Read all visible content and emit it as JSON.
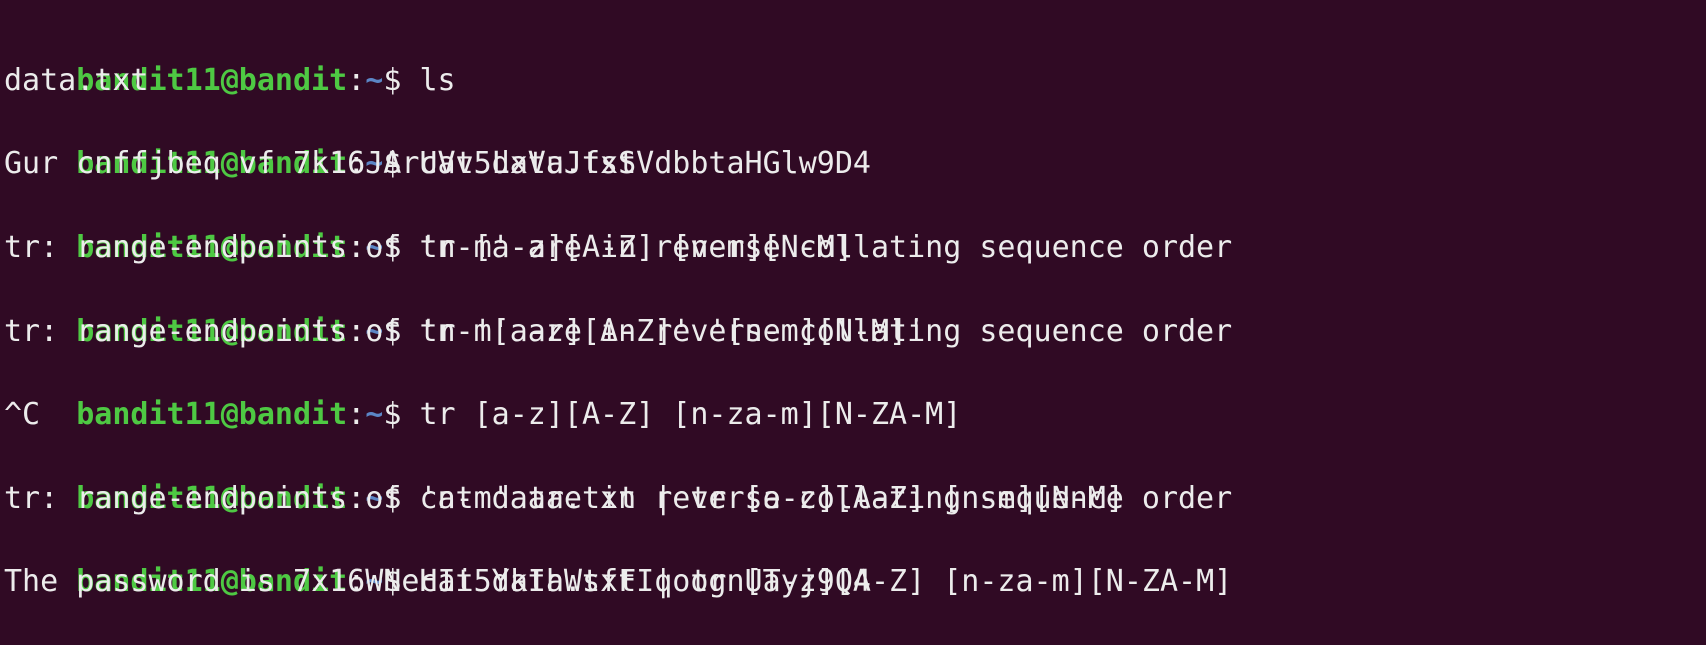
{
  "prompt": {
    "user_host": "bandit11@bandit",
    "colon": ":",
    "path": "~",
    "symbol": "$ "
  },
  "lines": [
    {
      "type": "command",
      "text": "ls"
    },
    {
      "type": "output",
      "text": "data.txt"
    },
    {
      "type": "command",
      "text": "cat data.txt"
    },
    {
      "type": "output",
      "text": "Gur cnffjbeq vf 7k16JArUVv5LxVuJfsSVdbbtaHGlw9D4"
    },
    {
      "type": "command",
      "text": "tr [a-z][A-Z] [n-m][N-M]"
    },
    {
      "type": "output",
      "text": "tr: range-endpoints of 'n-m' are in reverse collating sequence order"
    },
    {
      "type": "command",
      "text": "tr '[a-z][A-Z]' '[n-m][N-M]'"
    },
    {
      "type": "output",
      "text": "tr: range-endpoints of 'n-m' are in reverse collating sequence order"
    },
    {
      "type": "command",
      "text": "tr [a-z][A-Z] [n-za-m][N-ZA-M]"
    },
    {
      "type": "output",
      "text": "^C"
    },
    {
      "type": "command",
      "text": "cat data.txt | tr [a-z][A-Z] [n-m][N-M]"
    },
    {
      "type": "output",
      "text": "tr: range-endpoints of 'n-m' are in reverse collating sequence order"
    },
    {
      "type": "command",
      "text": "cat data.txt | tr [a-z][A-Z] [n-za-m][N-ZA-M]"
    },
    {
      "type": "output",
      "text": "The password is 7x16WNeHIi5YkIhWsfFIqoognUTyj9Q4"
    }
  ]
}
